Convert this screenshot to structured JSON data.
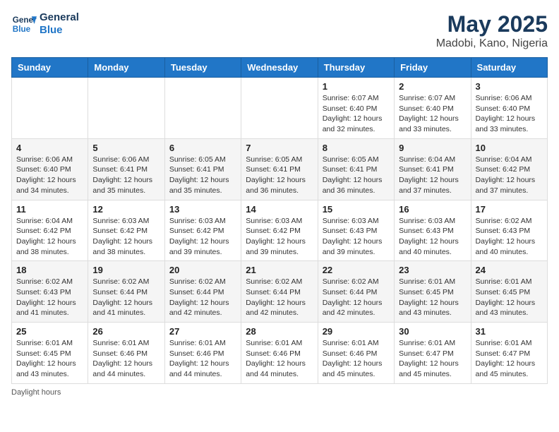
{
  "header": {
    "logo_line1": "General",
    "logo_line2": "Blue",
    "title": "May 2025",
    "subtitle": "Madobi, Kano, Nigeria"
  },
  "days": [
    "Sunday",
    "Monday",
    "Tuesday",
    "Wednesday",
    "Thursday",
    "Friday",
    "Saturday"
  ],
  "weeks": [
    [
      {
        "date": "",
        "info": ""
      },
      {
        "date": "",
        "info": ""
      },
      {
        "date": "",
        "info": ""
      },
      {
        "date": "",
        "info": ""
      },
      {
        "date": "1",
        "info": "Sunrise: 6:07 AM\nSunset: 6:40 PM\nDaylight: 12 hours and 32 minutes."
      },
      {
        "date": "2",
        "info": "Sunrise: 6:07 AM\nSunset: 6:40 PM\nDaylight: 12 hours and 33 minutes."
      },
      {
        "date": "3",
        "info": "Sunrise: 6:06 AM\nSunset: 6:40 PM\nDaylight: 12 hours and 33 minutes."
      }
    ],
    [
      {
        "date": "4",
        "info": "Sunrise: 6:06 AM\nSunset: 6:40 PM\nDaylight: 12 hours and 34 minutes."
      },
      {
        "date": "5",
        "info": "Sunrise: 6:06 AM\nSunset: 6:41 PM\nDaylight: 12 hours and 35 minutes."
      },
      {
        "date": "6",
        "info": "Sunrise: 6:05 AM\nSunset: 6:41 PM\nDaylight: 12 hours and 35 minutes."
      },
      {
        "date": "7",
        "info": "Sunrise: 6:05 AM\nSunset: 6:41 PM\nDaylight: 12 hours and 36 minutes."
      },
      {
        "date": "8",
        "info": "Sunrise: 6:05 AM\nSunset: 6:41 PM\nDaylight: 12 hours and 36 minutes."
      },
      {
        "date": "9",
        "info": "Sunrise: 6:04 AM\nSunset: 6:41 PM\nDaylight: 12 hours and 37 minutes."
      },
      {
        "date": "10",
        "info": "Sunrise: 6:04 AM\nSunset: 6:42 PM\nDaylight: 12 hours and 37 minutes."
      }
    ],
    [
      {
        "date": "11",
        "info": "Sunrise: 6:04 AM\nSunset: 6:42 PM\nDaylight: 12 hours and 38 minutes."
      },
      {
        "date": "12",
        "info": "Sunrise: 6:03 AM\nSunset: 6:42 PM\nDaylight: 12 hours and 38 minutes."
      },
      {
        "date": "13",
        "info": "Sunrise: 6:03 AM\nSunset: 6:42 PM\nDaylight: 12 hours and 39 minutes."
      },
      {
        "date": "14",
        "info": "Sunrise: 6:03 AM\nSunset: 6:42 PM\nDaylight: 12 hours and 39 minutes."
      },
      {
        "date": "15",
        "info": "Sunrise: 6:03 AM\nSunset: 6:43 PM\nDaylight: 12 hours and 39 minutes."
      },
      {
        "date": "16",
        "info": "Sunrise: 6:03 AM\nSunset: 6:43 PM\nDaylight: 12 hours and 40 minutes."
      },
      {
        "date": "17",
        "info": "Sunrise: 6:02 AM\nSunset: 6:43 PM\nDaylight: 12 hours and 40 minutes."
      }
    ],
    [
      {
        "date": "18",
        "info": "Sunrise: 6:02 AM\nSunset: 6:43 PM\nDaylight: 12 hours and 41 minutes."
      },
      {
        "date": "19",
        "info": "Sunrise: 6:02 AM\nSunset: 6:44 PM\nDaylight: 12 hours and 41 minutes."
      },
      {
        "date": "20",
        "info": "Sunrise: 6:02 AM\nSunset: 6:44 PM\nDaylight: 12 hours and 42 minutes."
      },
      {
        "date": "21",
        "info": "Sunrise: 6:02 AM\nSunset: 6:44 PM\nDaylight: 12 hours and 42 minutes."
      },
      {
        "date": "22",
        "info": "Sunrise: 6:02 AM\nSunset: 6:44 PM\nDaylight: 12 hours and 42 minutes."
      },
      {
        "date": "23",
        "info": "Sunrise: 6:01 AM\nSunset: 6:45 PM\nDaylight: 12 hours and 43 minutes."
      },
      {
        "date": "24",
        "info": "Sunrise: 6:01 AM\nSunset: 6:45 PM\nDaylight: 12 hours and 43 minutes."
      }
    ],
    [
      {
        "date": "25",
        "info": "Sunrise: 6:01 AM\nSunset: 6:45 PM\nDaylight: 12 hours and 43 minutes."
      },
      {
        "date": "26",
        "info": "Sunrise: 6:01 AM\nSunset: 6:46 PM\nDaylight: 12 hours and 44 minutes."
      },
      {
        "date": "27",
        "info": "Sunrise: 6:01 AM\nSunset: 6:46 PM\nDaylight: 12 hours and 44 minutes."
      },
      {
        "date": "28",
        "info": "Sunrise: 6:01 AM\nSunset: 6:46 PM\nDaylight: 12 hours and 44 minutes."
      },
      {
        "date": "29",
        "info": "Sunrise: 6:01 AM\nSunset: 6:46 PM\nDaylight: 12 hours and 45 minutes."
      },
      {
        "date": "30",
        "info": "Sunrise: 6:01 AM\nSunset: 6:47 PM\nDaylight: 12 hours and 45 minutes."
      },
      {
        "date": "31",
        "info": "Sunrise: 6:01 AM\nSunset: 6:47 PM\nDaylight: 12 hours and 45 minutes."
      }
    ]
  ],
  "footer": "Daylight hours"
}
